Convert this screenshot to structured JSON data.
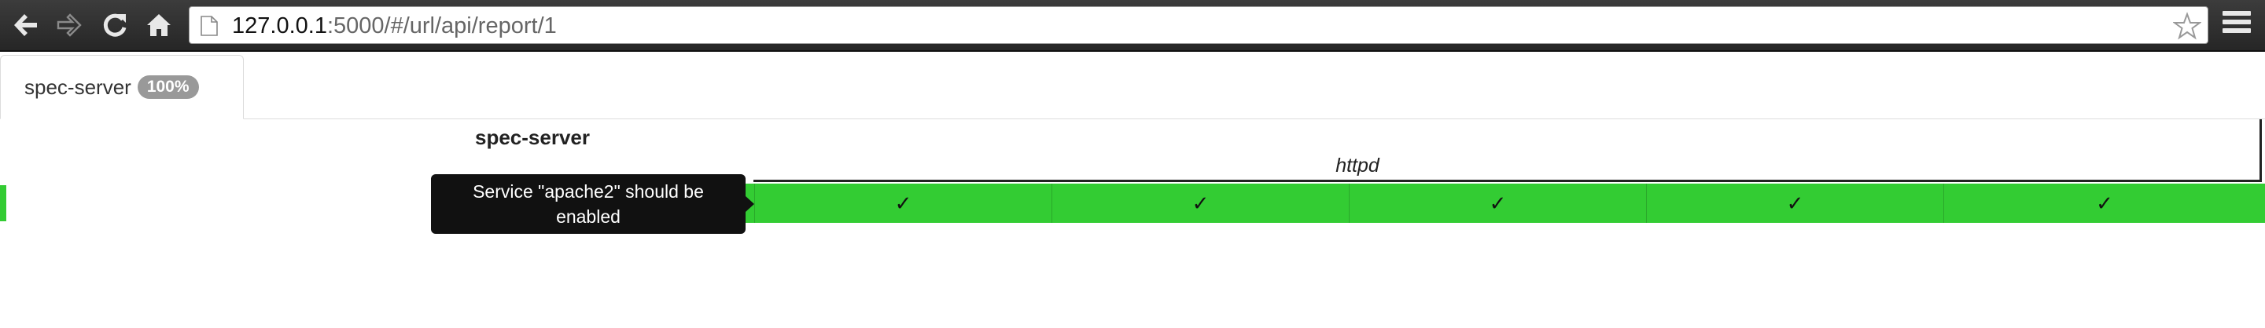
{
  "browser": {
    "url_host": "127.0.0.1",
    "url_rest": ":5000/#/url/api/report/1",
    "icons": [
      "back-arrow-icon",
      "forward-arrow-icon",
      "reload-icon",
      "home-icon",
      "page-icon",
      "star-icon",
      "menu-icon"
    ]
  },
  "tabs": [
    {
      "label": "spec-server",
      "badge": "100%"
    }
  ],
  "report": {
    "server_name": "spec-server",
    "group_label": "httpd",
    "results": [
      {
        "mark": "✓",
        "status": "pass"
      },
      {
        "mark": "✓",
        "status": "pass"
      },
      {
        "mark": "✓",
        "status": "pass"
      },
      {
        "mark": "✓",
        "status": "pass"
      },
      {
        "mark": "✓",
        "status": "pass"
      },
      {
        "mark": "✓",
        "status": "pass"
      }
    ],
    "tooltip": "Service \"apache2\" should be enabled"
  },
  "colors": {
    "pass": "#33cc33",
    "tooltip_bg": "#111111",
    "toolbar": "#2e2e2e"
  }
}
